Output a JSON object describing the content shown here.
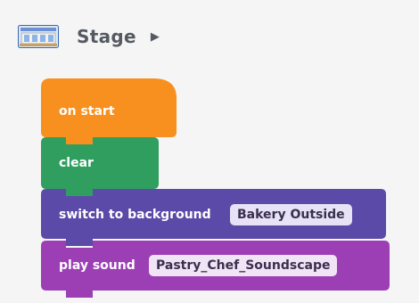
{
  "header": {
    "title": "Stage",
    "caret_icon": "caret-right-icon"
  },
  "blocks": {
    "on_start": {
      "label": "on start",
      "color": "#f7901e"
    },
    "clear": {
      "label": "clear",
      "color": "#2f9e5f"
    },
    "switch_background": {
      "label": "switch to background",
      "value": "Bakery Outside",
      "color": "#5b4aa8"
    },
    "play_sound": {
      "label": "play sound",
      "value": "Pastry_Chef_Soundscape",
      "color": "#9c3fb5"
    }
  }
}
